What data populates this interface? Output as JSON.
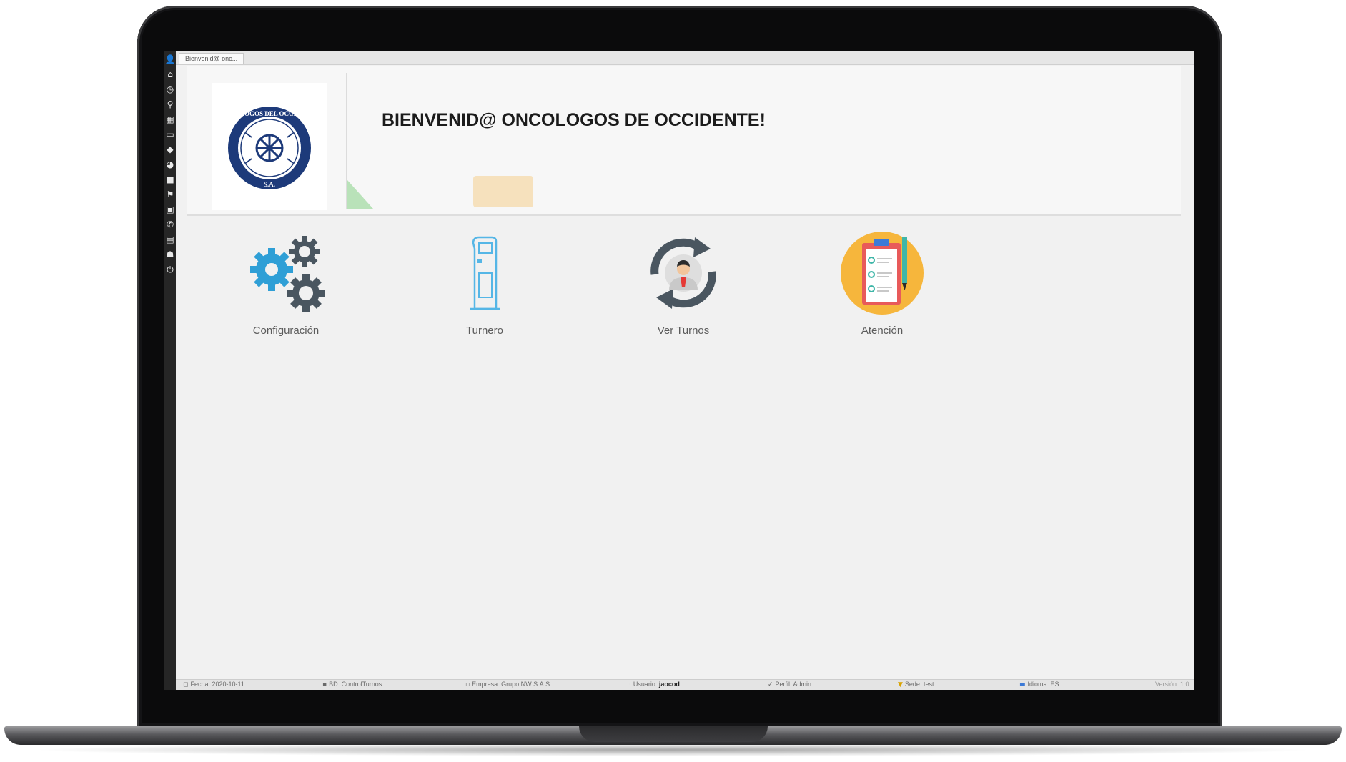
{
  "tab": {
    "label": "Bienvenid@ onc..."
  },
  "welcome": {
    "title": "BIENVENID@ ONCOLOGOS DE OCCIDENTE!"
  },
  "logo": {
    "text_top": "ONCOLOGOS DEL OCCIDENTE",
    "text_bottom": "S.A."
  },
  "sidebar": {
    "icons": [
      "user-icon",
      "home-icon",
      "clock-icon",
      "search-icon",
      "calculator-icon",
      "chat-icon",
      "tag-icon",
      "pie-chart-icon",
      "grid-icon",
      "flag-icon",
      "contact-icon",
      "phone-icon",
      "id-card-icon",
      "person-icon",
      "power-icon"
    ]
  },
  "tiles": [
    {
      "label": "Configuración",
      "icon": "gears-icon"
    },
    {
      "label": "Turnero",
      "icon": "kiosk-icon"
    },
    {
      "label": "Ver Turnos",
      "icon": "queue-refresh-icon"
    },
    {
      "label": "Atención",
      "icon": "clipboard-icon"
    }
  ],
  "statusbar": {
    "fecha": "Fecha: 2020-10-11",
    "bd": "BD: ControlTurnos",
    "empresa": "Empresa: Grupo NW S.A.S",
    "usuario_label": "Usuario:",
    "usuario_value": "jaocod",
    "perfil": "Perfil: Admin",
    "sede": "Sede: test",
    "idioma": "Idioma: ES",
    "version": "Versión: 1.0"
  },
  "colors": {
    "logo_blue": "#1d3a7a",
    "gear_blue": "#2f9fd6",
    "gear_dark": "#4a5660",
    "kiosk": "#55b6e6",
    "clipboard_circle": "#f6b63c"
  }
}
